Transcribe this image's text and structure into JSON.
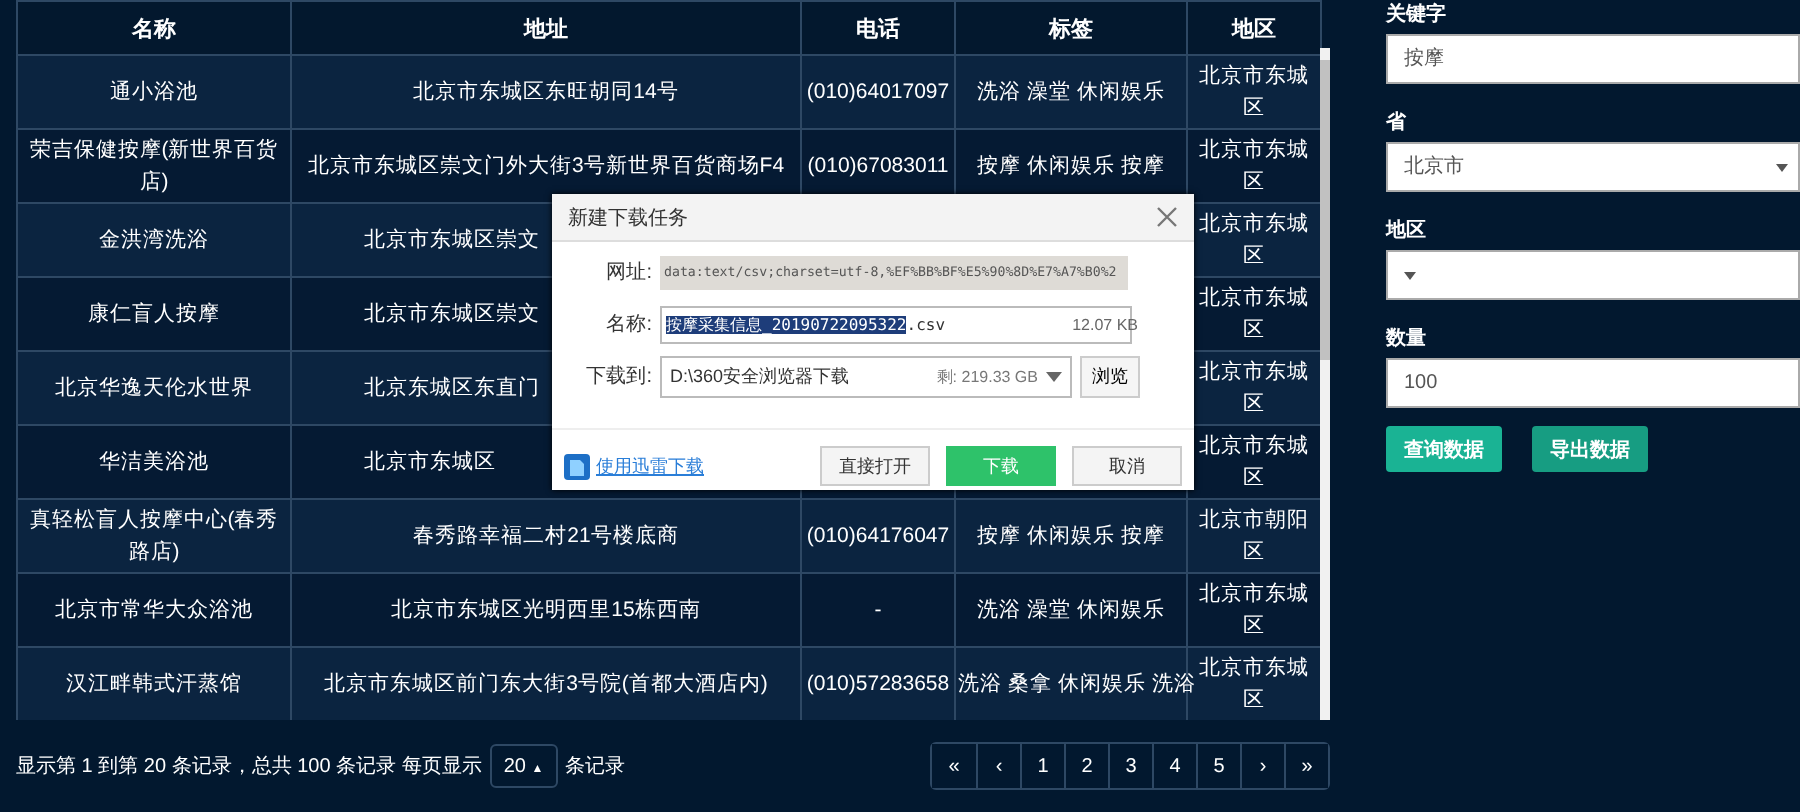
{
  "table": {
    "columns": [
      "名称",
      "地址",
      "电话",
      "标签",
      "地区"
    ],
    "rows": [
      {
        "name": "通小浴池",
        "address": "北京市东城区东旺胡同14号",
        "phone": "(010)64017097",
        "tags": "洗浴 澡堂 休闲娱乐",
        "region": "北京市东城区"
      },
      {
        "name": "荣吉保健按摩(新世界百货店)",
        "address": "北京市东城区崇文门外大街3号新世界百货商场F4",
        "phone": "(010)67083011",
        "tags": "按摩 休闲娱乐 按摩",
        "region": "北京市东城区"
      },
      {
        "name": "金洪湾洗浴",
        "address": "北京市东城区崇文",
        "address_cut": true,
        "region": "北京市东城区"
      },
      {
        "name": "康仁盲人按摩",
        "address": "北京市东城区崇文",
        "address_cut": true,
        "region": "北京市东城区"
      },
      {
        "name": "北京华逸天伦水世界",
        "address": "北京东城区东直门",
        "address_cut": true,
        "region": "北京市东城区"
      },
      {
        "name": "华洁美浴池",
        "address": "北京市东城区",
        "address_cut": true,
        "region": "北京市东城区"
      },
      {
        "name": "真轻松盲人按摩中心(春秀路店)",
        "address": "春秀路幸福二村21号楼底商",
        "phone": "(010)64176047",
        "tags": "按摩 休闲娱乐 按摩",
        "region": "北京市朝阳区"
      },
      {
        "name": "北京市常华大众浴池",
        "address": "北京市东城区光明西里15栋西南",
        "phone": "-",
        "tags": "洗浴 澡堂 休闲娱乐",
        "region": "北京市东城区"
      },
      {
        "name": "汉江畔韩式汗蒸馆",
        "address": "北京市东城区前门东大街3号院(首都大酒店内)",
        "phone": "(010)57283658",
        "tags": "洗浴 桑拿 休闲娱乐 洗浴",
        "region": "北京市东城区"
      }
    ]
  },
  "footer": {
    "summary": "显示第 1 到第 20 条记录，总共 100 条记录 每页显示",
    "page_size": "20",
    "page_size_caret": "▲",
    "suffix": "条记录"
  },
  "pagination": [
    {
      "label": "«",
      "selected": false
    },
    {
      "label": "‹",
      "selected": false
    },
    {
      "label": "1",
      "selected": false
    },
    {
      "label": "2",
      "selected": false
    },
    {
      "label": "3",
      "selected": false
    },
    {
      "label": "4",
      "selected": false
    },
    {
      "label": "5",
      "selected": false
    },
    {
      "label": "›",
      "selected": false
    },
    {
      "label": "»",
      "selected": false
    }
  ],
  "filters": [
    {
      "kind": "input",
      "label": "关键字",
      "value": "按摩"
    },
    {
      "kind": "select",
      "label": "省",
      "value": "北京市"
    },
    {
      "kind": "select",
      "label": "地区"
    },
    {
      "kind": "input",
      "label": "数量",
      "value": "100"
    }
  ],
  "buttons": [
    "查询数据",
    "导出数据"
  ],
  "dialog": {
    "title": "新建下载任务",
    "url_label": "网址:",
    "url": "data:text/csv;charset=utf-8,%EF%BB%BF%E5%90%8D%E7%A7%B0%2",
    "name_label": "名称:",
    "name_selected": "按摩采集信息_20190722095322",
    "name_ext": ".csv",
    "size": "12.07 KB",
    "dest_label": "下载到:",
    "dest": "D:\\360安全浏览器下载",
    "free": "剩: 219.33 GB",
    "browse": "浏览",
    "link": "使用迅雷下载",
    "actions": [
      {
        "label": "直接打开",
        "kind": "default"
      },
      {
        "label": "下载",
        "kind": "primary"
      },
      {
        "label": "取消",
        "kind": "default"
      }
    ]
  }
}
